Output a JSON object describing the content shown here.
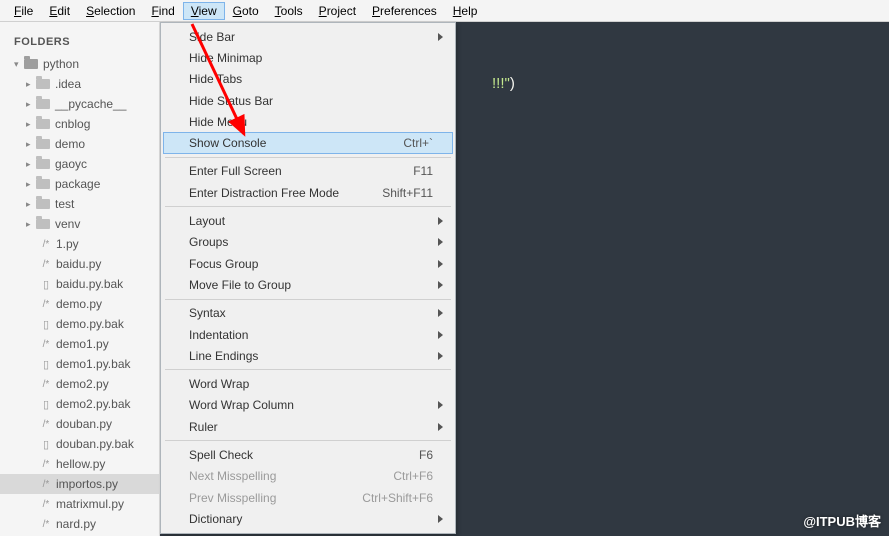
{
  "menubar": {
    "items": [
      {
        "letter": "F",
        "rest": "ile"
      },
      {
        "letter": "E",
        "rest": "dit"
      },
      {
        "letter": "S",
        "rest": "election"
      },
      {
        "letter": "F",
        "rest": "ind"
      },
      {
        "letter": "V",
        "rest": "iew"
      },
      {
        "letter": "G",
        "rest": "oto"
      },
      {
        "letter": "T",
        "rest": "ools"
      },
      {
        "letter": "P",
        "rest": "roject"
      },
      {
        "letter": "P",
        "rest": "references"
      },
      {
        "letter": "H",
        "rest": "elp"
      }
    ],
    "active_index": 4
  },
  "sidebar": {
    "heading": "FOLDERS",
    "root": "python",
    "folders": [
      ".idea",
      "__pycache__",
      "cnblog",
      "demo",
      "gaoyc",
      "package",
      "test",
      "venv"
    ],
    "files": [
      {
        "name": "1.py",
        "kind": "py"
      },
      {
        "name": "baidu.py",
        "kind": "py"
      },
      {
        "name": "baidu.py.bak",
        "kind": "file"
      },
      {
        "name": "demo.py",
        "kind": "py"
      },
      {
        "name": "demo.py.bak",
        "kind": "file"
      },
      {
        "name": "demo1.py",
        "kind": "py"
      },
      {
        "name": "demo1.py.bak",
        "kind": "file"
      },
      {
        "name": "demo2.py",
        "kind": "py"
      },
      {
        "name": "demo2.py.bak",
        "kind": "file"
      },
      {
        "name": "douban.py",
        "kind": "py"
      },
      {
        "name": "douban.py.bak",
        "kind": "file"
      },
      {
        "name": "hellow.py",
        "kind": "py"
      },
      {
        "name": "importos.py",
        "kind": "py",
        "selected": true
      },
      {
        "name": "matrixmul.py",
        "kind": "py"
      },
      {
        "name": "nard.py",
        "kind": "py"
      }
    ]
  },
  "view_menu": {
    "groups": [
      [
        {
          "label": "Side Bar",
          "submenu": true
        },
        {
          "label": "Hide Minimap"
        },
        {
          "label": "Hide Tabs"
        },
        {
          "label": "Hide Status Bar"
        },
        {
          "label": "Hide Menu"
        },
        {
          "label": "Show Console",
          "shortcut": "Ctrl+`",
          "hover": true
        }
      ],
      [
        {
          "label": "Enter Full Screen",
          "shortcut": "F11"
        },
        {
          "label": "Enter Distraction Free Mode",
          "shortcut": "Shift+F11"
        }
      ],
      [
        {
          "label": "Layout",
          "submenu": true
        },
        {
          "label": "Groups",
          "submenu": true
        },
        {
          "label": "Focus Group",
          "submenu": true
        },
        {
          "label": "Move File to Group",
          "submenu": true
        }
      ],
      [
        {
          "label": "Syntax",
          "submenu": true
        },
        {
          "label": "Indentation",
          "submenu": true
        },
        {
          "label": "Line Endings",
          "submenu": true
        }
      ],
      [
        {
          "label": "Word Wrap"
        },
        {
          "label": "Word Wrap Column",
          "submenu": true
        },
        {
          "label": "Ruler",
          "submenu": true
        }
      ],
      [
        {
          "label": "Spell Check",
          "shortcut": "F6"
        },
        {
          "label": "Next Misspelling",
          "shortcut": "Ctrl+F6",
          "disabled": true
        },
        {
          "label": "Prev Misspelling",
          "shortcut": "Ctrl+Shift+F6",
          "disabled": true
        },
        {
          "label": "Dictionary",
          "submenu": true
        }
      ]
    ]
  },
  "editor": {
    "visible_fragment_str": "!!!\"",
    "visible_fragment_paren": ")"
  },
  "watermark": "@ITPUB博客"
}
